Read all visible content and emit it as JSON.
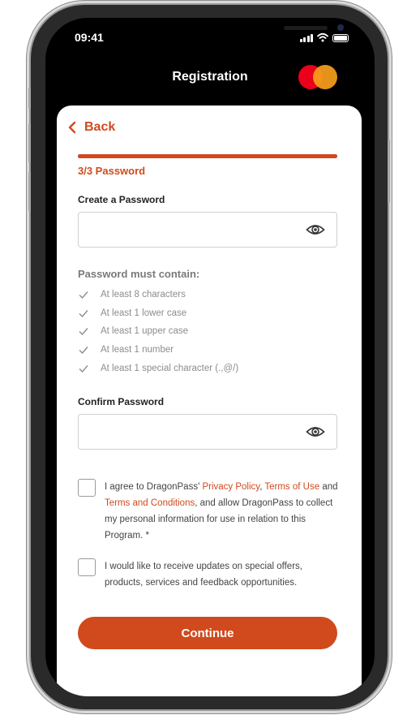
{
  "status_bar": {
    "time": "09:41"
  },
  "header": {
    "title": "Registration",
    "brand_colors": {
      "red": "#eb001b",
      "orange": "#f79e1b"
    }
  },
  "nav": {
    "back_label": "Back"
  },
  "progress": {
    "step_label": "3/3 Password",
    "fraction": 1.0,
    "color": "#d04a1d"
  },
  "password": {
    "label": "Create a Password",
    "value": "",
    "placeholder": "",
    "toggle_icon": "eye-icon"
  },
  "rules": {
    "title": "Password must contain:",
    "items": [
      "At least 8 characters",
      "At least 1 lower case",
      "At least 1 upper case",
      "At least 1 number",
      "At least 1 special character (.,@/)"
    ]
  },
  "confirm": {
    "label": "Confirm Password",
    "value": "",
    "placeholder": "",
    "toggle_icon": "eye-icon"
  },
  "consent1": {
    "prefix": "I agree to DragonPass' ",
    "privacy_link": "Privacy Policy",
    "sep1": ", ",
    "terms_of_use_link": "Terms of Use",
    "and": " and ",
    "terms_conditions_link": "Terms and Conditions",
    "suffix": ", and allow DragonPass to collect my personal information for use in relation to this Program. *",
    "checked": false
  },
  "consent2": {
    "text": "I would like to receive updates on special offers, products, services and feedback opportunities.",
    "checked": false
  },
  "continue_label": "Continue",
  "accent_color": "#d04a1d"
}
